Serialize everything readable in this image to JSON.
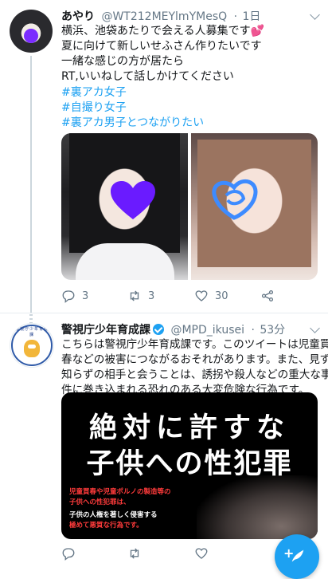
{
  "tweet1": {
    "name": "あやり",
    "handle": "@WT212MEYlmYMesQ",
    "time": "1日",
    "lines": [
      "横浜、池袋あたりで会える人募集です",
      "夏に向けて新しいせふさん作りたいです",
      "一緒な感じの方が居たら",
      "RT,いいねして話しかけてください"
    ],
    "heart": "💕",
    "hashtags": [
      "#裏アカ女子",
      "#自撮り女子",
      "#裏アカ男子とつながりたい"
    ],
    "replies": "3",
    "retweets": "3",
    "likes": "30"
  },
  "tweet2": {
    "name": "警視庁少年育成課",
    "handle": "@MPD_ikusei",
    "time": "53分",
    "avatar_text": "警視庁少年育成課",
    "lines": [
      "こちらは警視庁少年育成課です。このツイートは児童買",
      "春などの被害につながるおそれがあります。また、見ず",
      "知らずの相手と会うことは、誘拐や殺人などの重大な事",
      "件に巻き込まれる恐れのある大変危険な行為です。"
    ],
    "banner": {
      "line1": "絶対に許すな",
      "line2": "子供への性犯罪",
      "warn1": "児童買春や児童ポルノの製造等の",
      "warn2": "子供への性犯罪は、",
      "warn3": "子供の人権を著しく侵害する",
      "warn4": "極めて悪質な行為です。"
    }
  },
  "colors": {
    "accent": "#1da1f2",
    "muted": "#657786",
    "warning_red": "#ff3b3b"
  },
  "icons": [
    "reply-icon",
    "retweet-icon",
    "like-icon",
    "share-icon",
    "compose-icon"
  ]
}
